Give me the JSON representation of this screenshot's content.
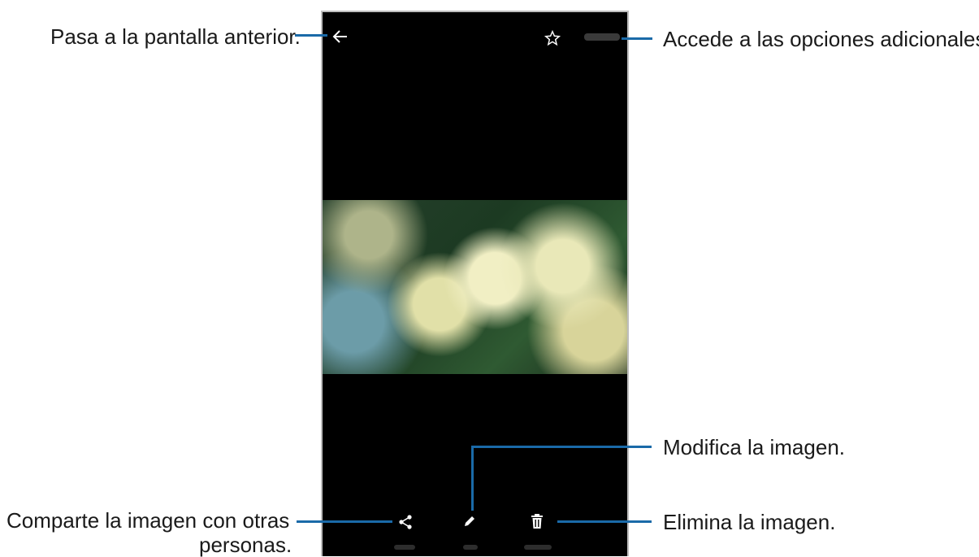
{
  "callouts": {
    "back": "Pasa a la pantalla anterior.",
    "more_options": "Accede a las opciones adicionales.",
    "edit": "Modifica la imagen.",
    "share_line1": "Comparte la imagen con otras",
    "share_line2": "personas.",
    "delete": "Elimina la imagen."
  },
  "icons": {
    "back": "back-arrow-icon",
    "favorite": "star-icon",
    "share": "share-icon",
    "edit": "pencil-icon",
    "delete": "trash-icon"
  },
  "colors": {
    "callout_line": "#1a6aa8",
    "phone_bg": "#000000"
  }
}
